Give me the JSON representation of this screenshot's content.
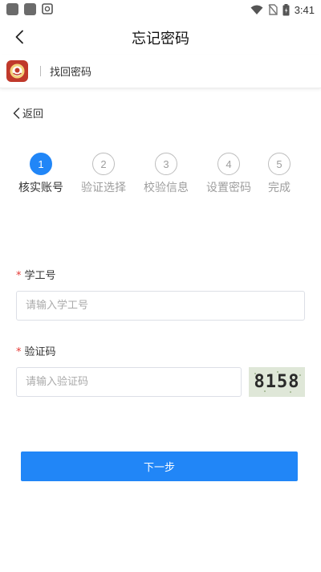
{
  "status_bar": {
    "time": "3:41",
    "icons": [
      "app-icon",
      "app-icon",
      "message-icon",
      "wifi-icon",
      "no-sim-icon",
      "battery-icon"
    ]
  },
  "title_bar": {
    "back_icon": "chevron-left-icon",
    "title": "忘记密码"
  },
  "app_header": {
    "logo": "school-logo",
    "label": "找回密码"
  },
  "back_link": {
    "label": "返回"
  },
  "steps": [
    {
      "number": "1",
      "label": "核实账号",
      "active": true
    },
    {
      "number": "2",
      "label": "验证选择",
      "active": false
    },
    {
      "number": "3",
      "label": "校验信息",
      "active": false
    },
    {
      "number": "4",
      "label": "设置密码",
      "active": false
    },
    {
      "number": "5",
      "label": "完成",
      "active": false
    }
  ],
  "form": {
    "student_id": {
      "required_mark": "*",
      "label": "学工号",
      "placeholder": "请输入学工号",
      "value": ""
    },
    "captcha": {
      "required_mark": "*",
      "label": "验证码",
      "placeholder": "请输入验证码",
      "value": "",
      "image_text": "8158"
    }
  },
  "next_button": {
    "label": "下一步"
  },
  "colors": {
    "primary": "#2186f7",
    "required": "#e53935",
    "step_inactive": "#9e9e9e"
  }
}
